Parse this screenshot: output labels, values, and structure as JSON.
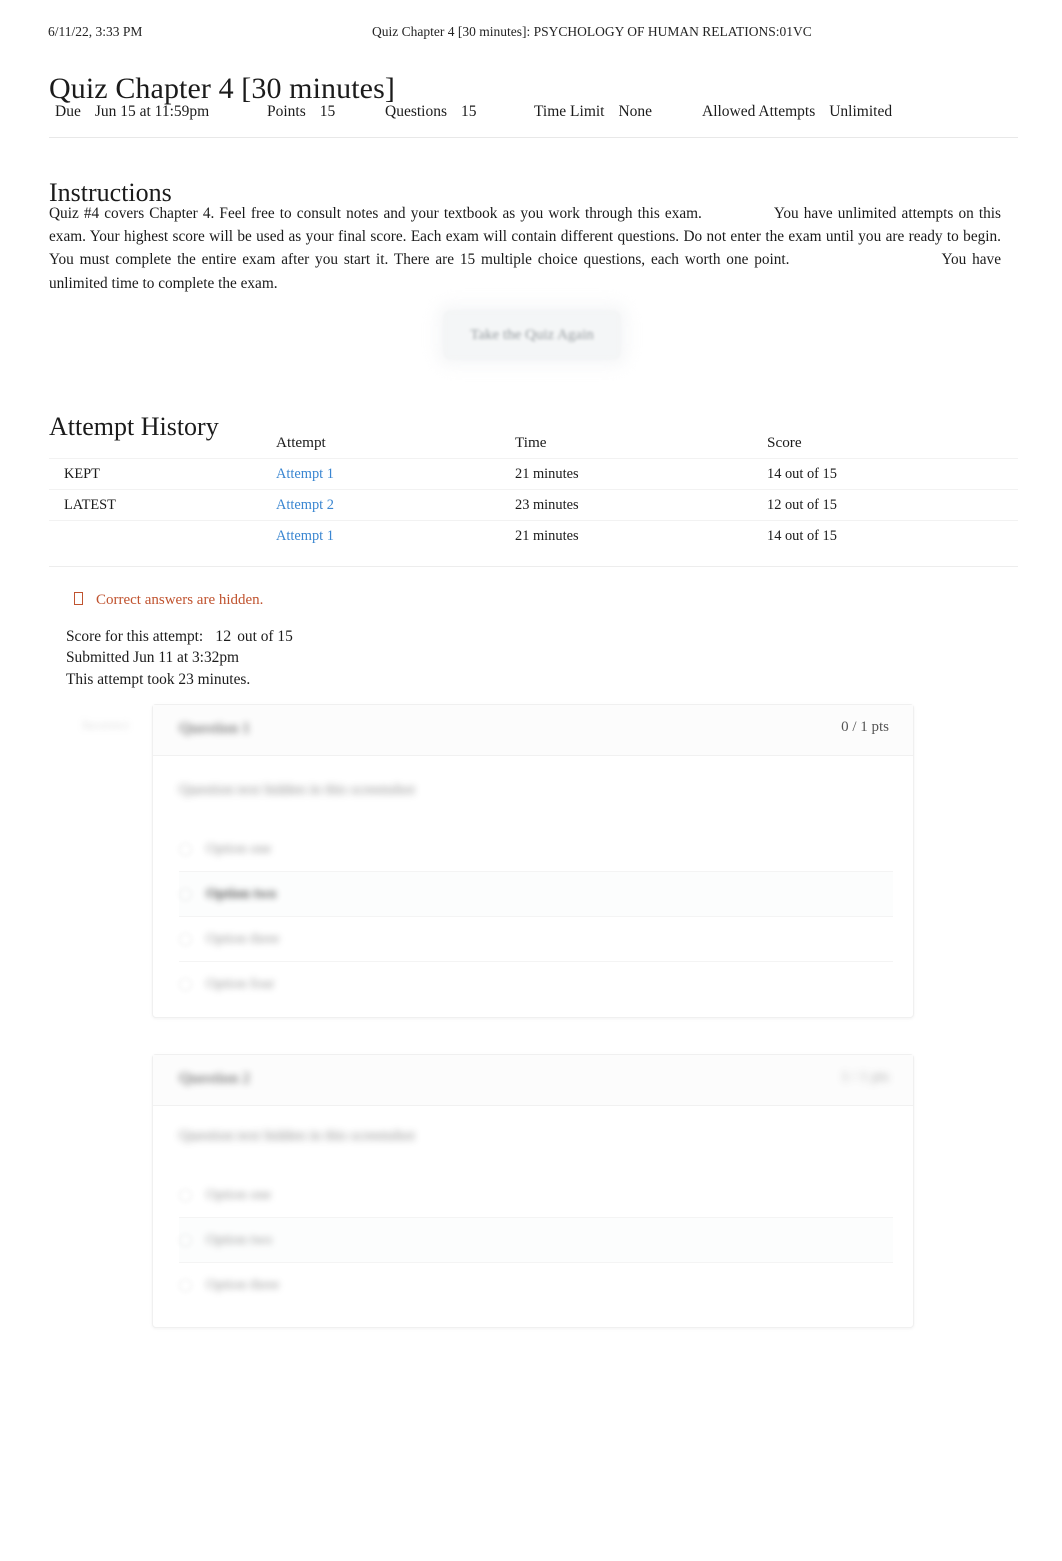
{
  "print_header": {
    "date": "6/11/22, 3:33 PM",
    "title": "Quiz Chapter 4 [30 minutes]: PSYCHOLOGY OF HUMAN RELATIONS:01VC"
  },
  "page_title": "Quiz Chapter 4 [30 minutes]",
  "meta": {
    "due_label": "Due",
    "due_value": "Jun 15 at 11:59pm",
    "points_label": "Points",
    "points_value": "15",
    "questions_label": "Questions",
    "questions_value": "15",
    "time_limit_label": "Time Limit",
    "time_limit_value": "None",
    "allowed_attempts_label": "Allowed Attempts",
    "allowed_attempts_value": "Unlimited"
  },
  "instructions": {
    "heading": "Instructions",
    "part1": "Quiz #4 covers Chapter 4. Feel free to consult notes and your textbook as you work through this exam.",
    "part2": "You have unlimited attempts on this exam. Your highest score will be used as your final score. Each exam will contain different questions. Do not enter the exam until you are ready to begin. You must complete the entire exam after you start it. There are 15 multiple choice questions, each worth one point.",
    "part3": "You have unlimited time to complete the exam."
  },
  "take_quiz_button": "Take the Quiz Again",
  "attempt_history": {
    "heading": "Attempt History",
    "columns": [
      "",
      "Attempt",
      "Time",
      "Score"
    ],
    "rows": [
      {
        "flag": "KEPT",
        "attempt": "Attempt 1",
        "time": "21 minutes",
        "score": "14 out of 15"
      },
      {
        "flag": "LATEST",
        "attempt": "Attempt 2",
        "time": "23 minutes",
        "score": "12 out of 15"
      },
      {
        "flag": "",
        "attempt": "Attempt 1",
        "time": "21 minutes",
        "score": "14 out of 15"
      }
    ]
  },
  "hidden_notice": "Correct answers are hidden.",
  "attempt_summary": {
    "score_label": "Score for this attempt:",
    "score_value": "12",
    "score_suffix": "out of 15",
    "submitted": "Submitted Jun 11 at 3:32pm",
    "duration": "This attempt took 23 minutes."
  },
  "questions": [
    {
      "status": "Incorrect",
      "title": "Question 1",
      "points": "0 / 1 pts",
      "text": "Question text hidden in this screenshot",
      "options": [
        {
          "label": "Option one",
          "selected": false
        },
        {
          "label": "Option two",
          "selected": true
        },
        {
          "label": "Option three",
          "selected": false
        },
        {
          "label": "Option four",
          "selected": false
        }
      ]
    },
    {
      "status": "",
      "title": "Question 2",
      "points": "1 / 1 pts",
      "text": "Question text hidden in this screenshot",
      "options": [
        {
          "label": "Option one",
          "selected": false
        },
        {
          "label": "Option two",
          "selected": false
        },
        {
          "label": "Option three",
          "selected": false
        }
      ]
    }
  ],
  "colors": {
    "link": "#3a86d1",
    "notice": "#c0532f",
    "text": "#1b1b1b"
  }
}
